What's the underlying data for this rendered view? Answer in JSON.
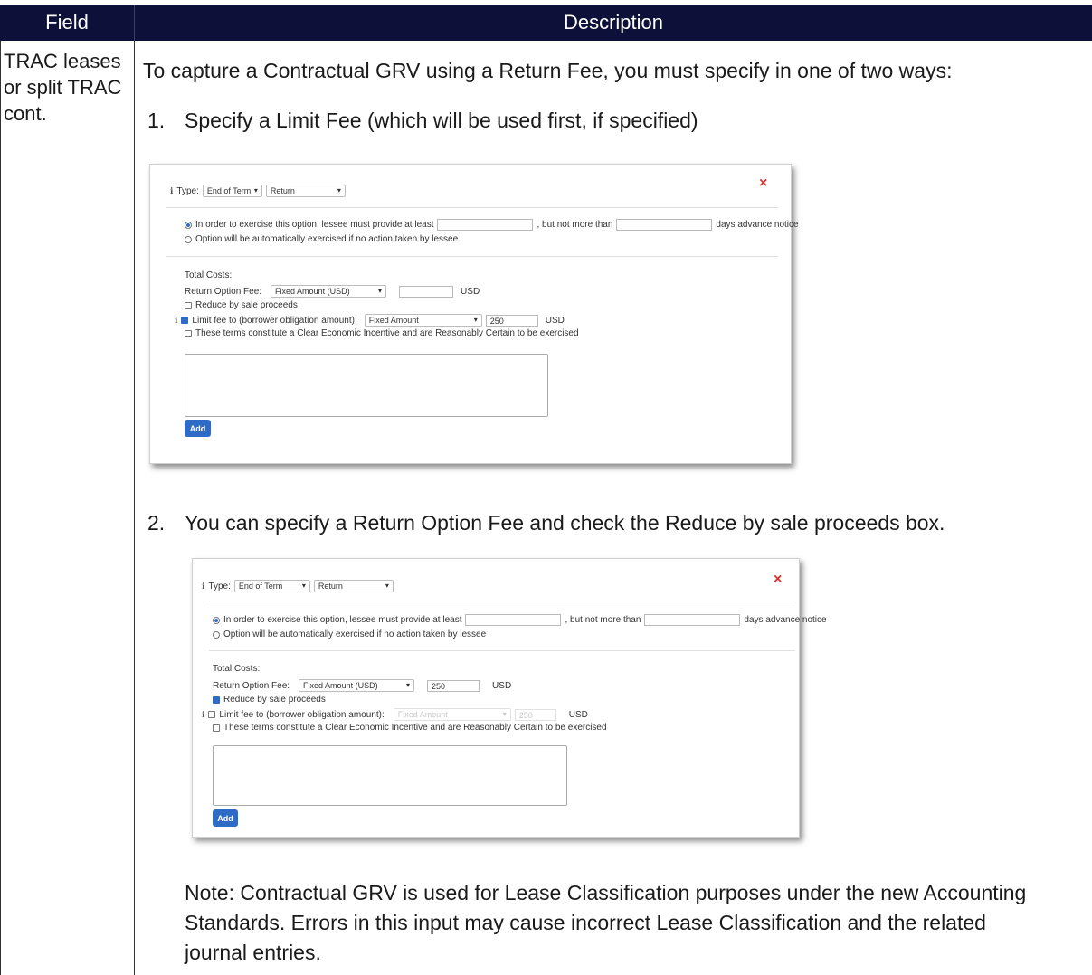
{
  "table": {
    "header": {
      "field": "Field",
      "description": "Description"
    },
    "field_value": "TRAC leases or split TRAC cont.",
    "lead": "To capture a Contractual GRV using a Return Fee, you must specify in one of two ways:",
    "items": [
      {
        "num": "1.",
        "text": "Specify a Limit Fee (which will be used first, if specified)"
      },
      {
        "num": "2.",
        "text": "You can specify a Return Option Fee and check the Reduce by sale proceeds box."
      }
    ],
    "note": "Note: Contractual GRV is used for Lease Classification purposes under the new Accounting Standards. Errors in this input may cause incorrect Lease Classification and the related journal entries."
  },
  "dialog1": {
    "close": "×",
    "type_label": "Type:",
    "type_value": "End of Term",
    "subtype_value": "Return",
    "notice_option": "In order to exercise this option, lessee must provide at least",
    "not_more_than": ", but not more than",
    "days_label": "days advance notice",
    "auto_option": "Option will be automatically exercised if no action taken by lessee",
    "total_costs": "Total Costs:",
    "return_fee_label": "Return Option Fee:",
    "return_fee_type": "Fixed Amount (USD)",
    "return_fee_value": "",
    "currency": "USD",
    "reduce_label": "Reduce by sale proceeds",
    "reduce_checked": false,
    "limit_label": "Limit fee to (borrower obligation amount):",
    "limit_checked": true,
    "limit_type": "Fixed Amount",
    "limit_value": "250",
    "incentive_label": "These terms constitute a Clear Economic Incentive and are Reasonably Certain to be exercised",
    "add_label": "Add"
  },
  "dialog2": {
    "close": "×",
    "type_label": "Type:",
    "type_value": "End of Term",
    "subtype_value": "Return",
    "notice_option": "In order to exercise this option, lessee must provide at least",
    "not_more_than": ", but not more than",
    "days_label": "days advance notice",
    "auto_option": "Option will be automatically exercised if no action taken by lessee",
    "total_costs": "Total Costs:",
    "return_fee_label": "Return Option Fee:",
    "return_fee_type": "Fixed Amount (USD)",
    "return_fee_value": "250",
    "currency": "USD",
    "reduce_label": "Reduce by sale proceeds",
    "reduce_checked": true,
    "limit_label": "Limit fee to (borrower obligation amount):",
    "limit_checked": false,
    "limit_type": "Fixed Amount",
    "limit_value": "250",
    "incentive_label": "These terms constitute a Clear Economic Incentive and are Reasonably Certain to be exercised",
    "add_label": "Add"
  },
  "colors": {
    "header_bg": "#0d1038",
    "accent": "#2e6bc7",
    "close": "#d9302a"
  }
}
